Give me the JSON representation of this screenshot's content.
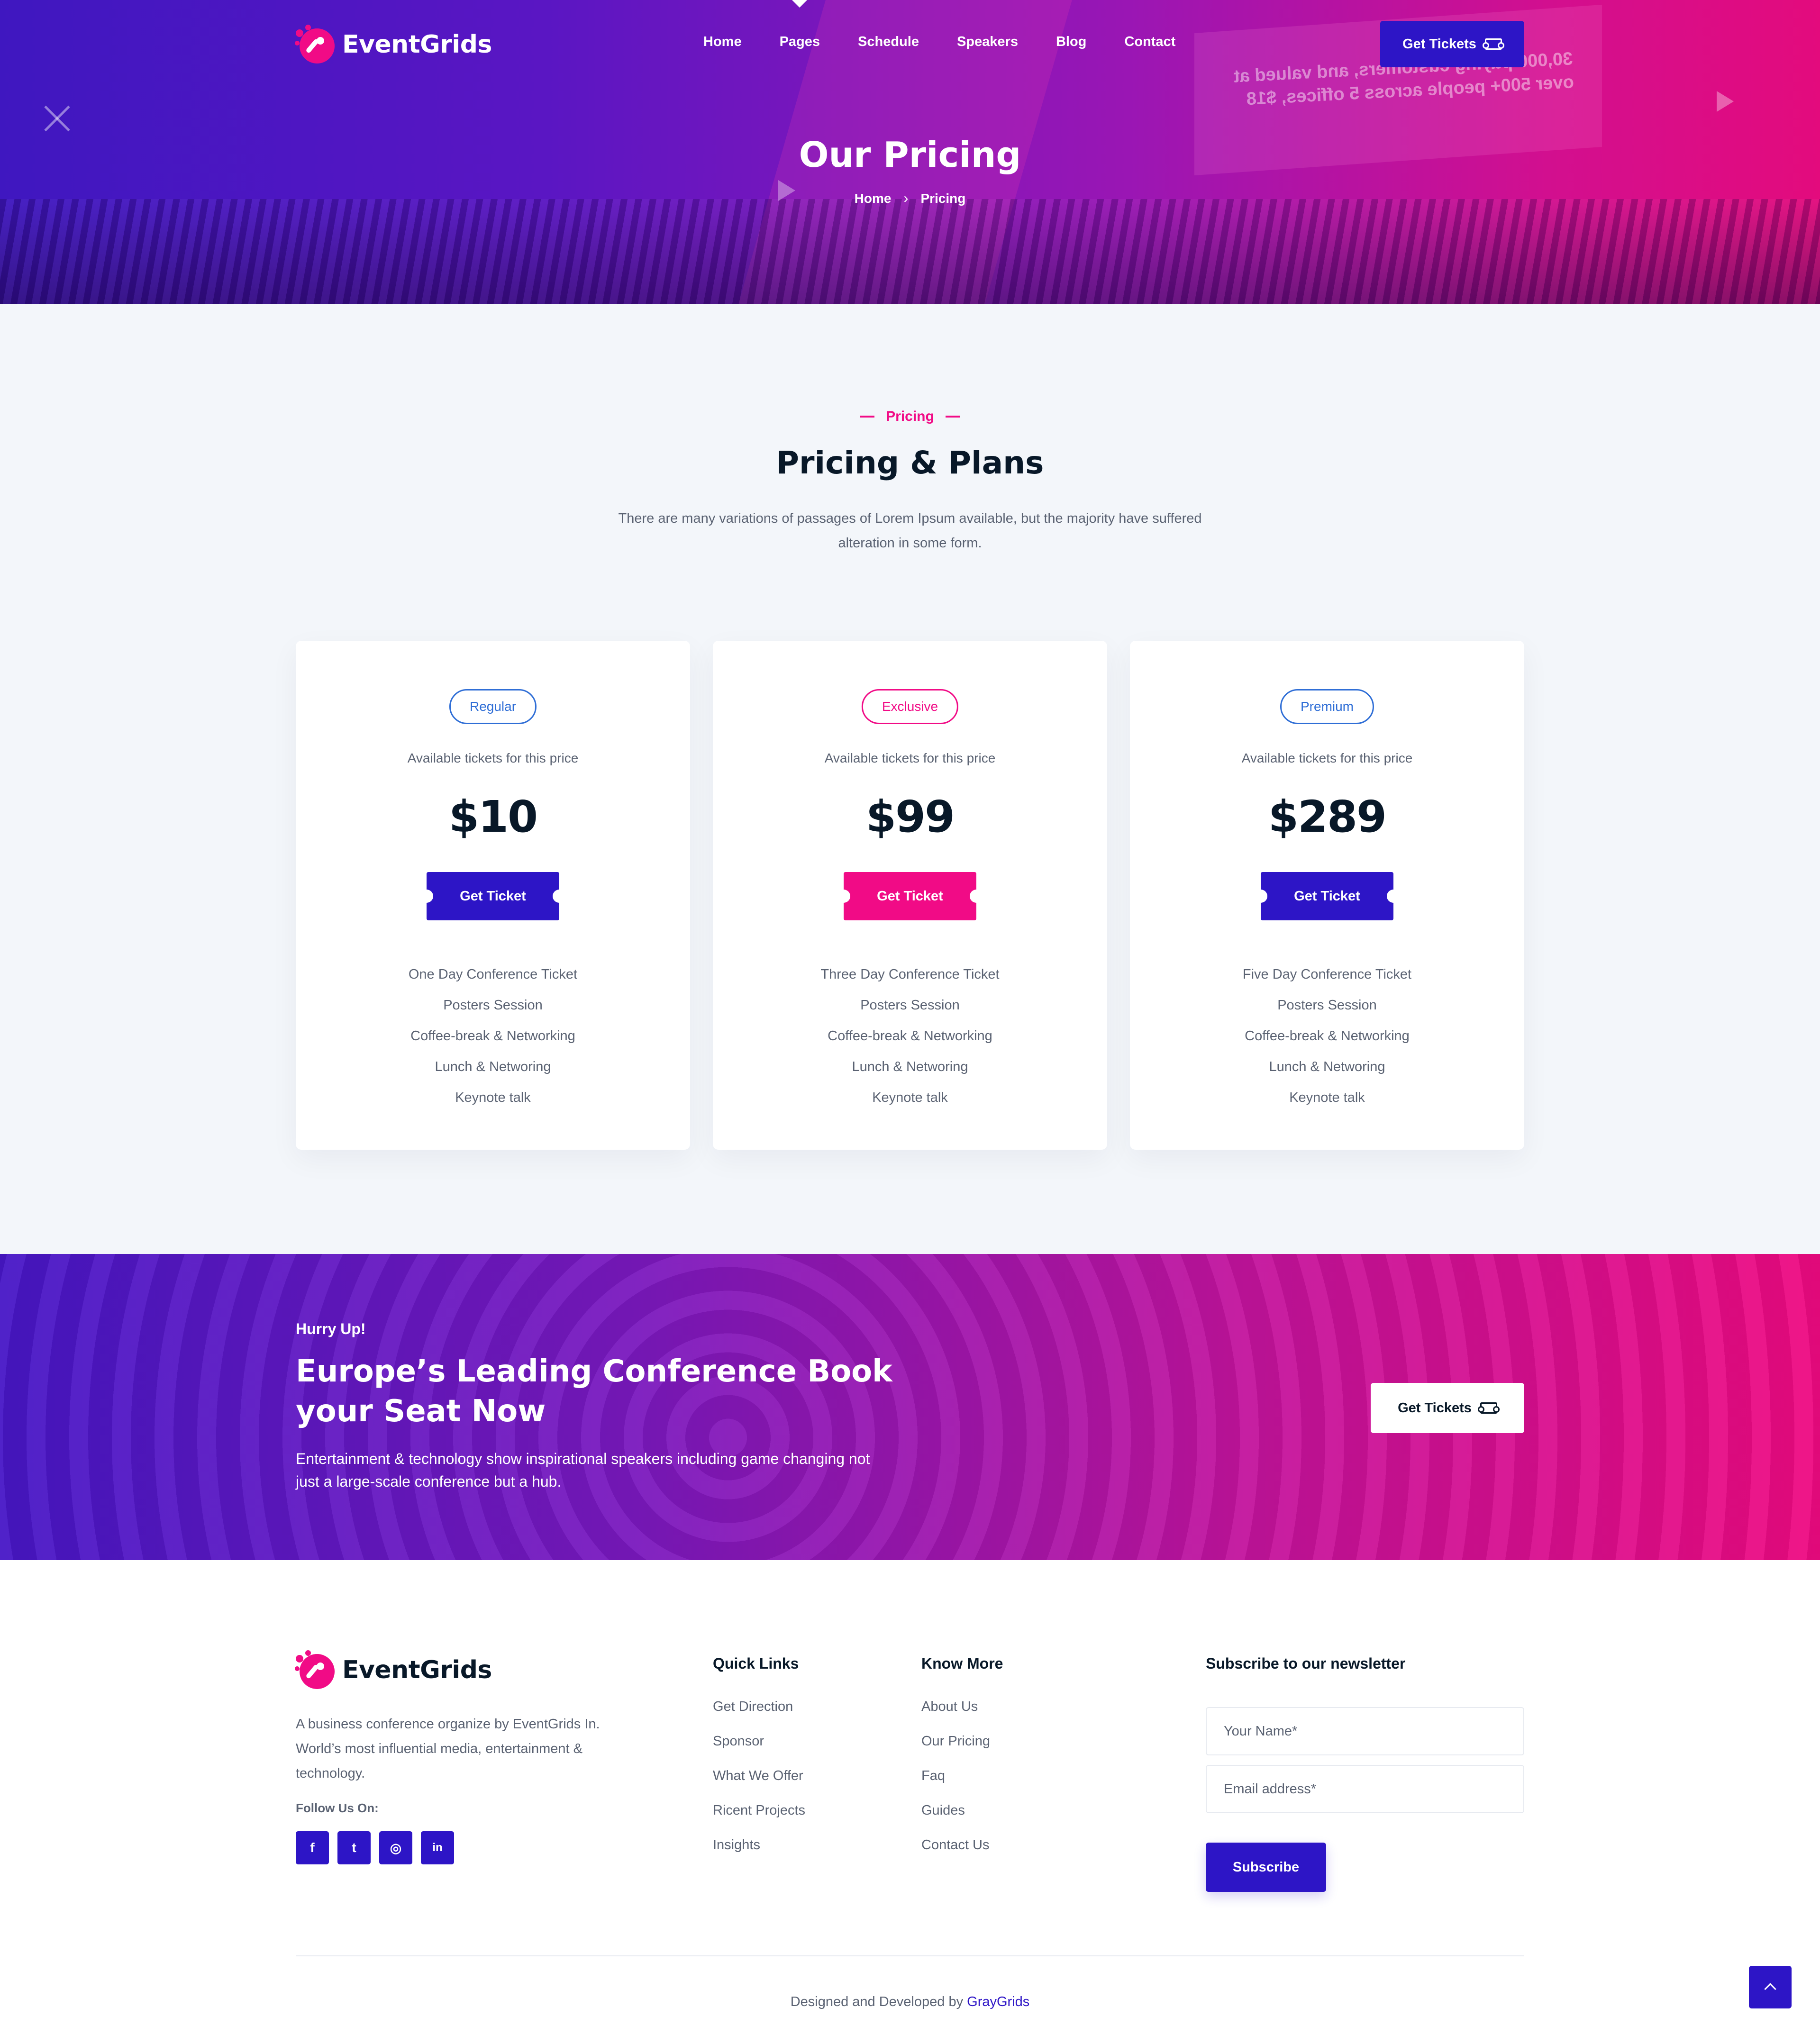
{
  "brand": {
    "name": "EventGrids"
  },
  "colors": {
    "primary": "#2d15c6",
    "accent": "#f10b86",
    "text": "#081828",
    "muted": "#5a6272"
  },
  "nav": {
    "items": [
      {
        "label": "Home"
      },
      {
        "label": "Pages"
      },
      {
        "label": "Schedule"
      },
      {
        "label": "Speakers"
      },
      {
        "label": "Blog"
      },
      {
        "label": "Contact"
      }
    ],
    "cta_label": "Get Tickets",
    "cta_icon": "ticket-icon"
  },
  "hero": {
    "title": "Our Pricing",
    "breadcrumb": [
      {
        "label": "Home"
      },
      {
        "label": "Pricing"
      }
    ],
    "screen_text": "30,000 paying customers, and valued at over 500+ people across 5 offices, $18"
  },
  "pricing": {
    "tag": "Pricing",
    "title": "Pricing & Plans",
    "description": "There are many variations of passages of Lorem Ipsum available, but the majority have suffered alteration in some form.",
    "plans": [
      {
        "badge": "Regular",
        "subtitle": "Available tickets for this price",
        "price": "$10",
        "button": "Get Ticket",
        "features": [
          "One Day Conference Ticket",
          "Posters Session",
          "Coffee-break & Networking",
          "Lunch & Networing",
          "Keynote talk"
        ]
      },
      {
        "badge": "Exclusive",
        "subtitle": "Available tickets for this price",
        "price": "$99",
        "button": "Get Ticket",
        "features": [
          "Three Day Conference Ticket",
          "Posters Session",
          "Coffee-break & Networking",
          "Lunch & Networing",
          "Keynote talk"
        ]
      },
      {
        "badge": "Premium",
        "subtitle": "Available tickets for this price",
        "price": "$289",
        "button": "Get Ticket",
        "features": [
          "Five Day Conference Ticket",
          "Posters Session",
          "Coffee-break & Networking",
          "Lunch & Networing",
          "Keynote talk"
        ]
      }
    ]
  },
  "cta": {
    "kicker": "Hurry Up!",
    "title": "Europe’s Leading Conference Book your Seat Now",
    "text": "Entertainment & technology show inspirational speakers including game changing not just a large-scale conference but a hub.",
    "button": "Get Tickets"
  },
  "footer": {
    "about": "A business conference organize by EventGrids In. World’s most influential media, entertainment & technology.",
    "follow_label": "Follow Us On:",
    "socials": [
      {
        "icon": "facebook-icon",
        "glyph": "f"
      },
      {
        "icon": "twitter-icon",
        "glyph": "t"
      },
      {
        "icon": "instagram-icon",
        "glyph": "◎"
      },
      {
        "icon": "linkedin-icon",
        "glyph": "in"
      }
    ],
    "quick_links": {
      "title": "Quick Links",
      "items": [
        "Get Direction",
        "Sponsor",
        "What We Offer",
        "Ricent Projects",
        "Insights"
      ]
    },
    "know_more": {
      "title": "Know More",
      "items": [
        "About Us",
        "Our Pricing",
        "Faq",
        "Guides",
        "Contact Us"
      ]
    },
    "newsletter": {
      "title": "Subscribe to our newsletter",
      "name_placeholder": "Your Name*",
      "email_placeholder": "Email address*",
      "button": "Subscribe"
    },
    "credit_prefix": "Designed and Developed by",
    "credit_link": "GrayGrids"
  }
}
